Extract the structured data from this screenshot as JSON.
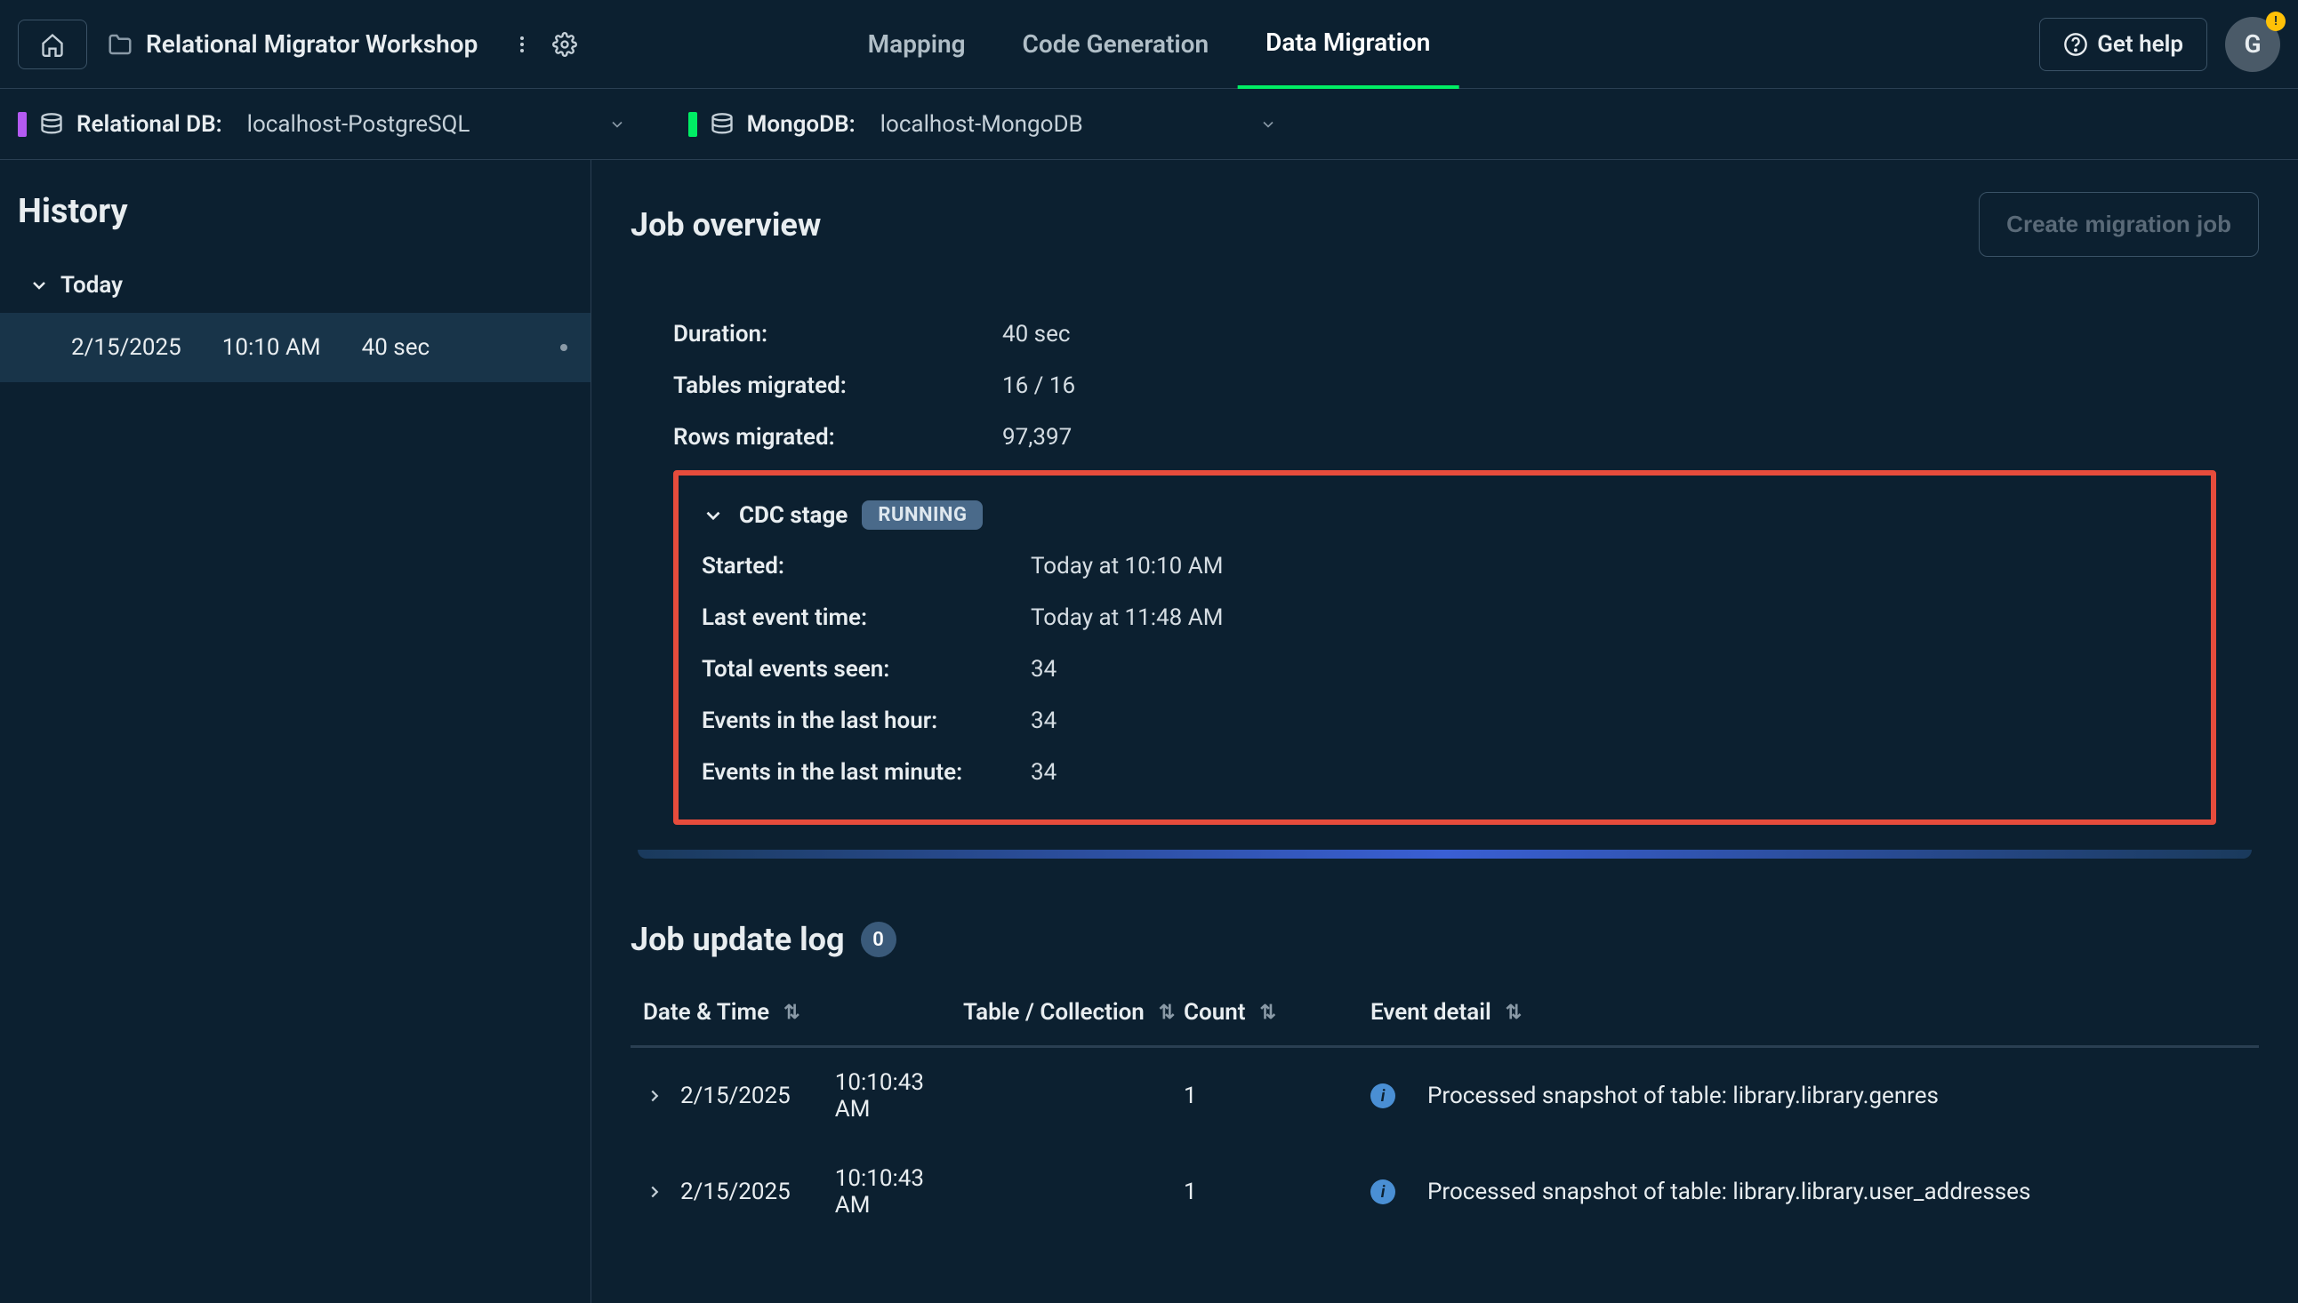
{
  "header": {
    "project_name": "Relational Migrator Workshop",
    "tabs": [
      {
        "label": "Mapping",
        "active": false
      },
      {
        "label": "Code Generation",
        "active": false
      },
      {
        "label": "Data Migration",
        "active": true
      }
    ],
    "get_help_label": "Get help",
    "avatar_initial": "G"
  },
  "connections": {
    "relational": {
      "label": "Relational DB:",
      "value": "localhost-PostgreSQL"
    },
    "mongodb": {
      "label": "MongoDB:",
      "value": "localhost-MongoDB"
    }
  },
  "sidebar": {
    "title": "History",
    "group_label": "Today",
    "items": [
      {
        "date": "2/15/2025",
        "time": "10:10 AM",
        "duration": "40 sec"
      }
    ]
  },
  "overview": {
    "title": "Job overview",
    "create_btn_label": "Create migration job",
    "rows": [
      {
        "label": "Duration:",
        "value": "40 sec"
      },
      {
        "label": "Tables migrated:",
        "value": "16 / 16"
      },
      {
        "label": "Rows migrated:",
        "value": "97,397"
      }
    ],
    "cdc": {
      "title": "CDC stage",
      "status": "RUNNING",
      "rows": [
        {
          "label": "Started:",
          "value": "Today at 10:10 AM"
        },
        {
          "label": "Last event time:",
          "value": "Today at 11:48 AM"
        },
        {
          "label": "Total events seen:",
          "value": "34"
        },
        {
          "label": "Events in the last hour:",
          "value": "34"
        },
        {
          "label": "Events in the last minute:",
          "value": "34"
        }
      ]
    }
  },
  "log": {
    "title": "Job update log",
    "badge_count": "0",
    "columns": {
      "datetime": "Date & Time",
      "table": "Table / Collection",
      "count": "Count",
      "detail": "Event detail"
    },
    "rows": [
      {
        "date": "2/15/2025",
        "time": "10:10:43 AM",
        "count": "1",
        "detail": "Processed snapshot of table: library.library.genres"
      },
      {
        "date": "2/15/2025",
        "time": "10:10:43 AM",
        "count": "1",
        "detail": "Processed snapshot of table: library.library.user_addresses"
      }
    ]
  }
}
